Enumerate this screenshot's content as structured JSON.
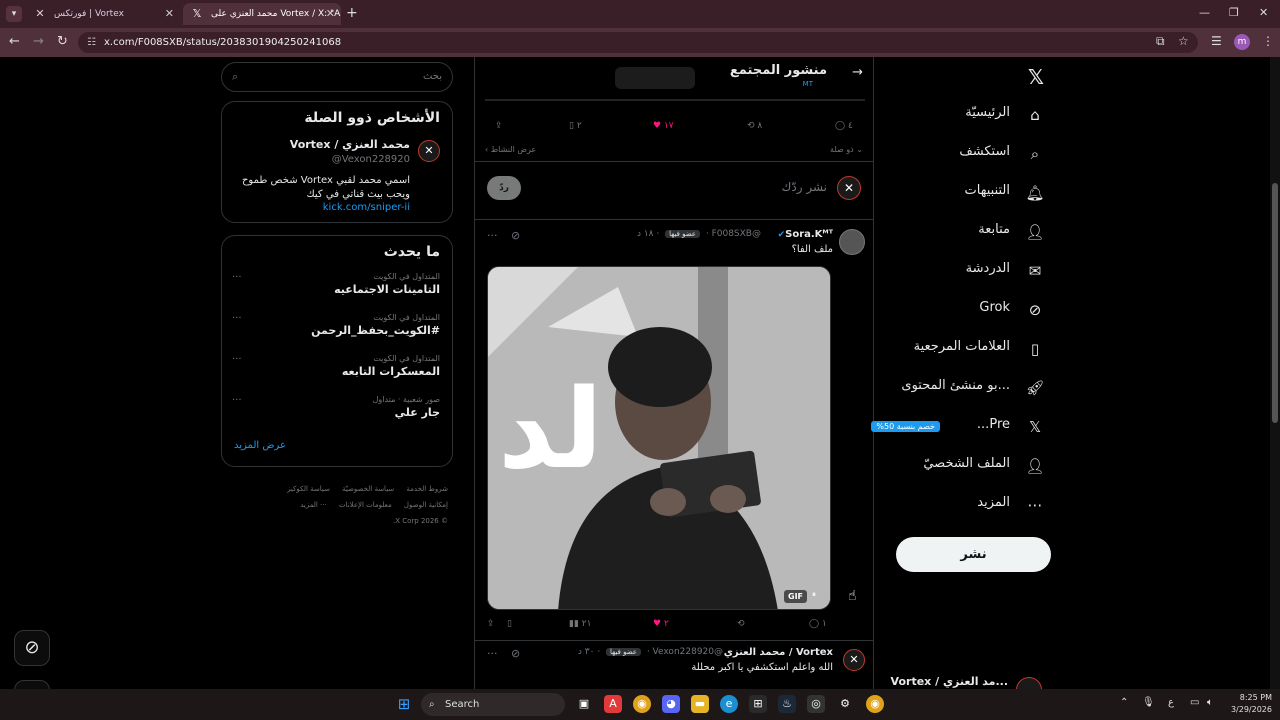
{
  "browser": {
    "tabs": [
      {
        "label": "فورتكس | Vortex",
        "favicon": "vortex-icon"
      },
      {
        "label": "محمد العنزي على Vortex / X: \"Al",
        "favicon": "x-icon"
      }
    ],
    "new_tab": "+",
    "url": "x.com/F008SXB/status/2038301904250241068",
    "profile_initial": "m"
  },
  "search": {
    "placeholder": "بحث"
  },
  "related": {
    "heading": "الأشخاص ذوو الصلة",
    "name": "محمد العنزي / Vortex",
    "handle": "@Vexon228920",
    "bio": "اسمي محمد لقبي Vortex شخص طموح ويحب بيث قناتي في كيك",
    "link": "kick.com/sniper-ii"
  },
  "trends": {
    "heading": "ما يحدث",
    "items": [
      {
        "meta": "المتداول في الكويت",
        "topic": "التامينات الاجتماعيه"
      },
      {
        "meta": "المتداول في الكويت",
        "topic": "#الكويت_بحفظ_الرحمن"
      },
      {
        "meta": "المتداول في الكويت",
        "topic": "المعسكرات التابعه"
      },
      {
        "meta": "صور شعبية · متداول",
        "topic": "جار علي"
      }
    ],
    "more_dots": "···",
    "show_more": "عرض المزيد"
  },
  "footer": {
    "line1": [
      "شروط الخدمة",
      "سياسة الخصوصيّة",
      "سياسة الكوكيز"
    ],
    "line2": [
      "إمكانية الوصول",
      "معلومات الإعلانات",
      "··· المزيد"
    ],
    "copyright": "© 2026 X Corp."
  },
  "main": {
    "community_title": "منشور المجتمع",
    "community_sub": "MT",
    "actions": {
      "replies": "٤",
      "reposts": "٨",
      "likes": "١٧",
      "bookmarks": "٢"
    },
    "related_label": "ذو صلة",
    "activity_label": "عرض النشاط",
    "reply_placeholder": "نشر ردّك",
    "reply_button": "ردّ",
    "tweet1": {
      "name": "Sora.Kᴹᵀ",
      "handle": "@F008SXB",
      "badge": "عضو فيها",
      "time": "١٨ د",
      "text": "ملف الفا؟",
      "gif": "GIF",
      "replies": "١",
      "likes": "٢",
      "views": "٢١"
    },
    "tweet2": {
      "name": "محمد العنزي / Vortex",
      "handle": "@Vexon228920",
      "badge": "عضو فيها",
      "time": "٣٠ د",
      "text": "الله واعلم استكشفي يا اكبر محللة"
    }
  },
  "nav": {
    "items": [
      {
        "label": "الرئيسيّة",
        "icon": "home-icon"
      },
      {
        "label": "استكشف",
        "icon": "search-icon"
      },
      {
        "label": "التنبيهات",
        "icon": "bell-icon"
      },
      {
        "label": "متابعة",
        "icon": "add-person-icon"
      },
      {
        "label": "الدردشة",
        "icon": "mail-icon"
      },
      {
        "label": "Grok",
        "icon": "grok-icon"
      },
      {
        "label": "العلامات المرجعية",
        "icon": "bookmark-icon"
      },
      {
        "label": "...بو منشئ المحتوى",
        "icon": "rocket-icon"
      },
      {
        "label": "Pre...",
        "icon": "x-icon",
        "promo": "خصم بنسبة 50%"
      },
      {
        "label": "الملف الشخصيّ",
        "icon": "person-icon"
      },
      {
        "label": "المزيد",
        "icon": "more-circle-icon"
      }
    ],
    "post_button": "نشر",
    "account_name": "...مد العنزي / Vortex"
  },
  "taskbar": {
    "search": "Search",
    "time": "8:25 PM",
    "date": "3/29/2026",
    "lang": "ع"
  },
  "colors": {
    "accent": "#1d9bf0",
    "like": "#f91880",
    "chrome": "#50303b"
  }
}
